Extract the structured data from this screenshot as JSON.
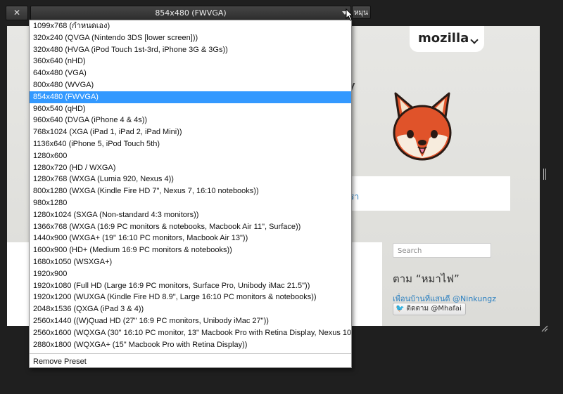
{
  "toolbar": {
    "close_label": "✕",
    "preset_value": "854x480 (FWVGA)",
    "rotate_label": "หมุน"
  },
  "presets": [
    "1099x768 (กำหนดเอง)",
    "320x240 (QVGA (Nintendo 3DS [lower screen]))",
    "320x480 (HVGA (iPod Touch 1st-3rd, iPhone 3G & 3Gs))",
    "360x640 (nHD)",
    "640x480 (VGA)",
    "800x480 (WVGA)",
    "854x480 (FWVGA)",
    "960x540 (qHD)",
    "960x640 (DVGA (iPhone 4 & 4s))",
    "768x1024 (XGA (iPad 1, iPad 2, iPad Mini))",
    "1136x640 (iPhone 5, iPod Touch 5th)",
    "1280x600",
    "1280x720 (HD / WXGA)",
    "1280x768 (WXGA (Lumia 920, Nexus 4))",
    "800x1280 (WXGA (Kindle Fire HD 7\", Nexus 7, 16:10 notebooks))",
    "980x1280",
    "1280x1024 (SXGA (Non-standard 4:3 monitors))",
    "1366x768 (WXGA (16:9 PC monitors & notebooks, Macbook Air 11\", Surface))",
    "1440x900 (WXGA+ (19\" 16:10 PC monitors, Macbook Air 13\"))",
    "1600x900 (HD+ (Medium 16:9 PC monitors & notebooks))",
    "1680x1050 (WSXGA+)",
    "1920x900",
    "1920x1080 (Full HD (Large 16:9 PC monitors, Surface Pro, Unibody iMac 21.5\"))",
    "1920x1200 (WUXGA (Kindle Fire HD 8.9\", Large 16:10 PC monitors & notebooks))",
    "2048x1536 (QXGA (iPad 3 & 4))",
    "2560x1440 ((W)Quad HD (27\" 16:9 PC monitors, Unibody iMac 27\"))",
    "2560x1600 (WQXGA (30\" 16:10 PC monitor, 13\" Macbook Pro with Retina Display, Nexus 10))",
    "2880x1800 (WQXGA+ (15\" Macbook Pro with Retina Display))"
  ],
  "selected_index": 6,
  "remove_preset_label": "Remove Preset",
  "page": {
    "brand": "mozilla",
    "header_fragment": "y",
    "card_link": "รา",
    "search_placeholder": "Search",
    "follow_heading": "ตาม “หมาไฟ”",
    "follow_link": "เพื่อนบ้านที่แสนดี @Ninkungz",
    "follow_button": "ติดตาม @Mhafai"
  },
  "colors": {
    "selection": "#3399ff",
    "background": "#1f1f1f",
    "mascot_fur": "#e0532a"
  }
}
